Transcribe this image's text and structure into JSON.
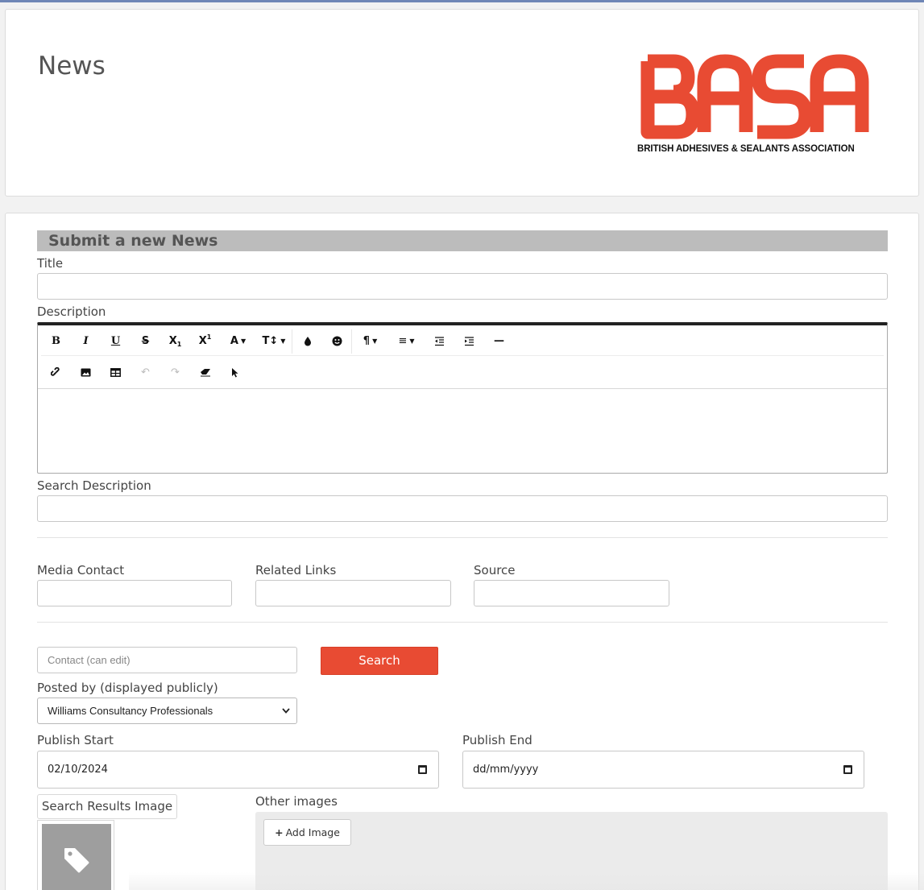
{
  "header": {
    "title": "News",
    "logo": {
      "letters": "BASA",
      "caption": "BRITISH ADHESIVES & SEALANTS ASSOCIATION",
      "color": "#E84B33"
    }
  },
  "form": {
    "section_title": "Submit a new News",
    "title_label": "Title",
    "title_value": "",
    "description_label": "Description",
    "editor": {
      "toolbar_row1": [
        {
          "icon": "bold-icon",
          "glyph": "B"
        },
        {
          "icon": "italic-icon",
          "glyph": "I"
        },
        {
          "icon": "underline-icon",
          "glyph": "U"
        },
        {
          "icon": "strikethrough-icon",
          "glyph": "S"
        },
        {
          "icon": "subscript-icon",
          "glyph": "X₁"
        },
        {
          "icon": "superscript-icon",
          "glyph": "X¹"
        },
        {
          "icon": "font-color-icon",
          "glyph": "A"
        },
        {
          "icon": "font-size-icon",
          "glyph": "T↕"
        },
        {
          "icon": "highlight-icon",
          "glyph": "💧"
        },
        {
          "icon": "emoji-icon",
          "glyph": "☻"
        },
        {
          "icon": "paragraph-icon",
          "glyph": "¶"
        },
        {
          "icon": "align-icon",
          "glyph": "≡"
        },
        {
          "icon": "outdent-icon",
          "glyph": "⇤"
        },
        {
          "icon": "indent-icon",
          "glyph": "⇥"
        },
        {
          "icon": "horizontal-rule-icon",
          "glyph": "—"
        }
      ],
      "toolbar_row2": [
        {
          "icon": "link-icon",
          "glyph": "🔗"
        },
        {
          "icon": "image-icon",
          "glyph": "▣"
        },
        {
          "icon": "table-icon",
          "glyph": "⊞"
        },
        {
          "icon": "undo-icon",
          "glyph": "↶"
        },
        {
          "icon": "redo-icon",
          "glyph": "↷"
        },
        {
          "icon": "eraser-icon",
          "glyph": "⌫"
        },
        {
          "icon": "select-pointer-icon",
          "glyph": "➤"
        }
      ],
      "content": ""
    },
    "search_description_label": "Search Description",
    "search_description_value": "",
    "media_contact_label": "Media Contact",
    "related_links_label": "Related Links",
    "source_label": "Source",
    "contact_placeholder": "Contact (can edit)",
    "search_button": "Search",
    "posted_by_label": "Posted by (displayed publicly)",
    "posted_by_value": "Williams Consultancy Professionals",
    "publish_start_label": "Publish Start",
    "publish_start_value": "02/10/2024",
    "publish_end_label": "Publish End",
    "publish_end_placeholder": "dd/mm/yyyy",
    "search_results_image_label": "Search Results Image",
    "other_images_label": "Other images",
    "add_image_button": "Add Image"
  },
  "colors": {
    "accent": "#E84B33",
    "section_bar": "#BCBCBC",
    "top_border": "#6F86B6"
  }
}
